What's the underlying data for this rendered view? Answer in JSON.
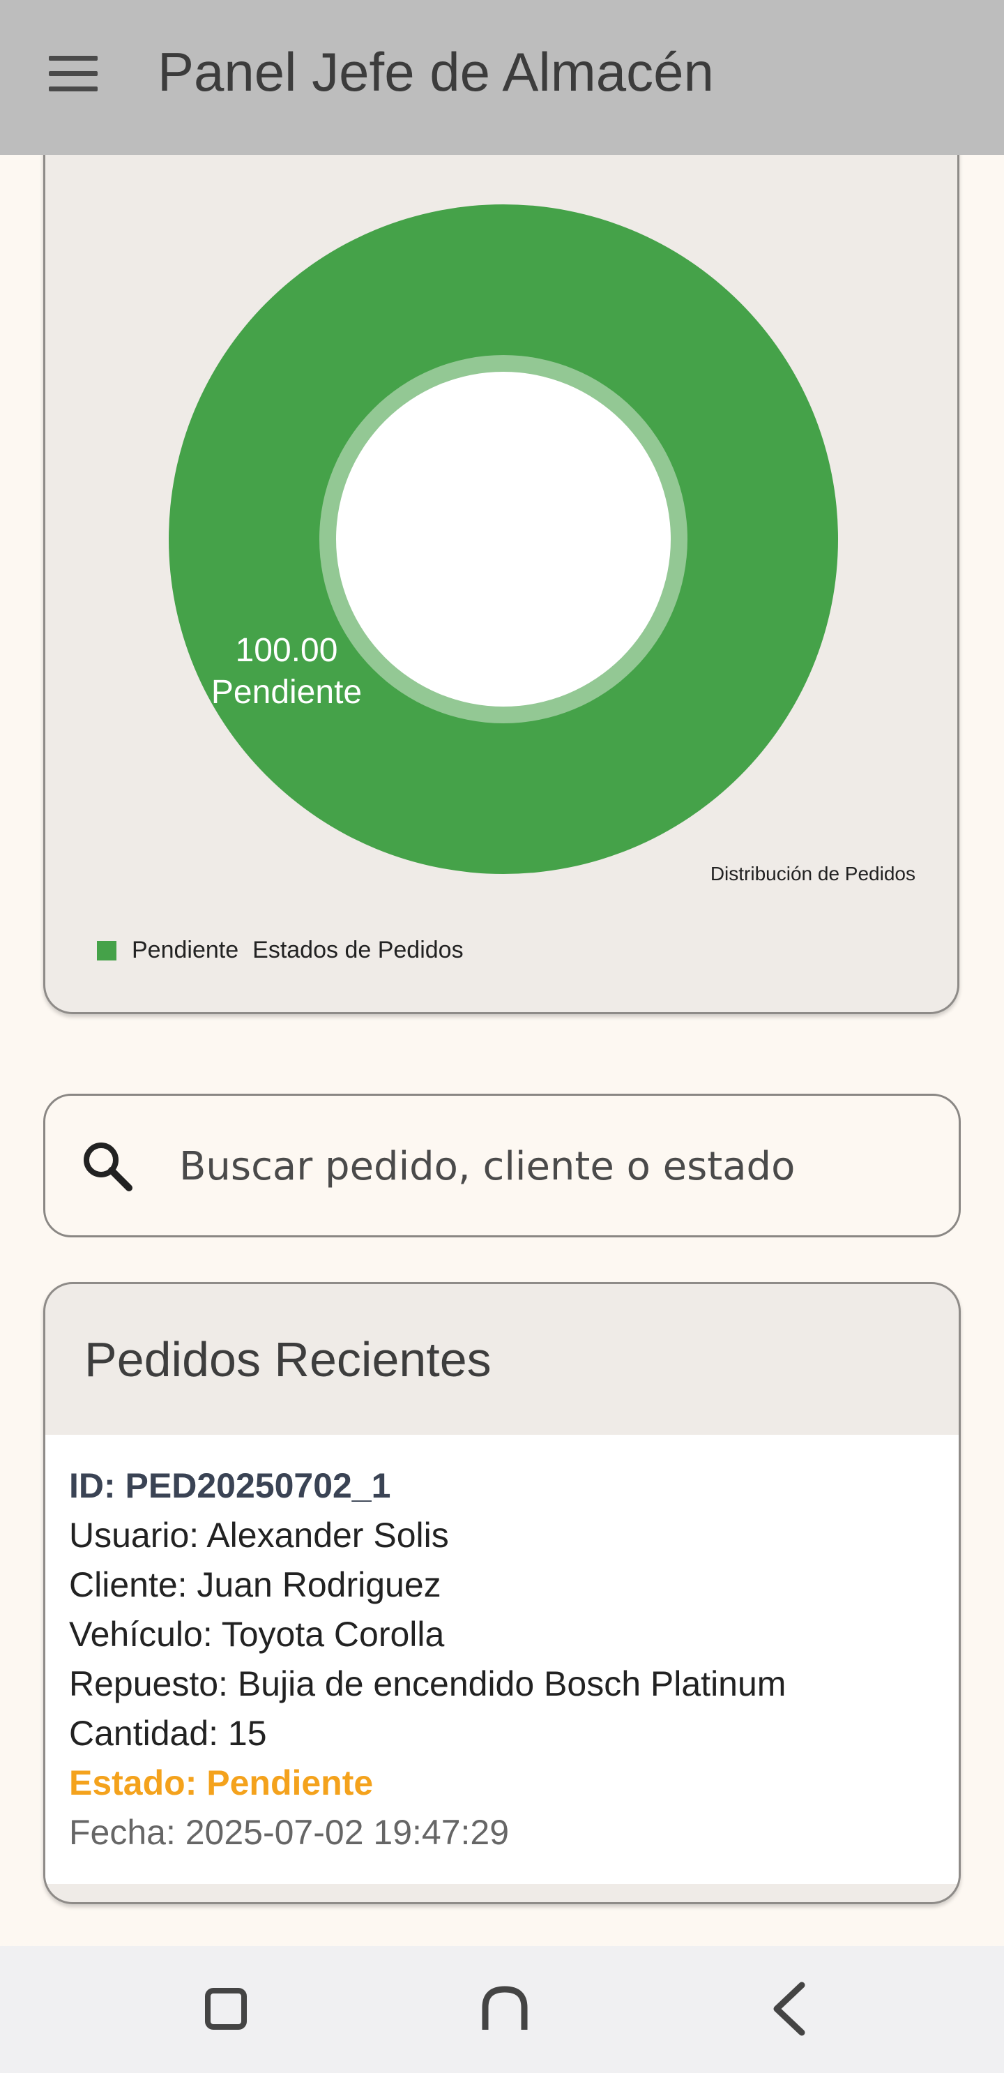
{
  "appbar": {
    "title": "Panel Jefe de Almacén"
  },
  "chart_data": {
    "type": "pie",
    "categories": [
      "Pendiente"
    ],
    "values": [
      100.0
    ],
    "slice_labels": [
      "100.00",
      "Pendiente"
    ],
    "caption": "Distribución de Pedidos",
    "legend_title": "Estados de Pedidos",
    "legend": [
      {
        "name": "Pendiente",
        "color": "#45a249"
      }
    ],
    "colors": {
      "slice": "#45a249",
      "inner_ring": "#93c894",
      "hole": "#ffffff"
    }
  },
  "search": {
    "placeholder": "Buscar pedido, cliente o estado"
  },
  "orders": {
    "title": "Pedidos Recientes",
    "items": [
      {
        "id": "ID: PED20250702_1",
        "usuario": "Usuario: Alexander Solis",
        "cliente": "Cliente: Juan Rodriguez",
        "vehiculo": "Vehículo: Toyota Corolla",
        "repuesto": "Repuesto: Bujia de encendido Bosch Platinum",
        "cantidad": "Cantidad: 15",
        "estado": "Estado: Pendiente",
        "fecha": "Fecha: 2025-07-02 19:47:29"
      }
    ]
  },
  "colors": {
    "status_pending": "#f4a21c",
    "appbar": "#bdbdbd"
  },
  "navbar": {
    "icons": [
      "square-icon",
      "home-icon",
      "back-icon"
    ]
  }
}
